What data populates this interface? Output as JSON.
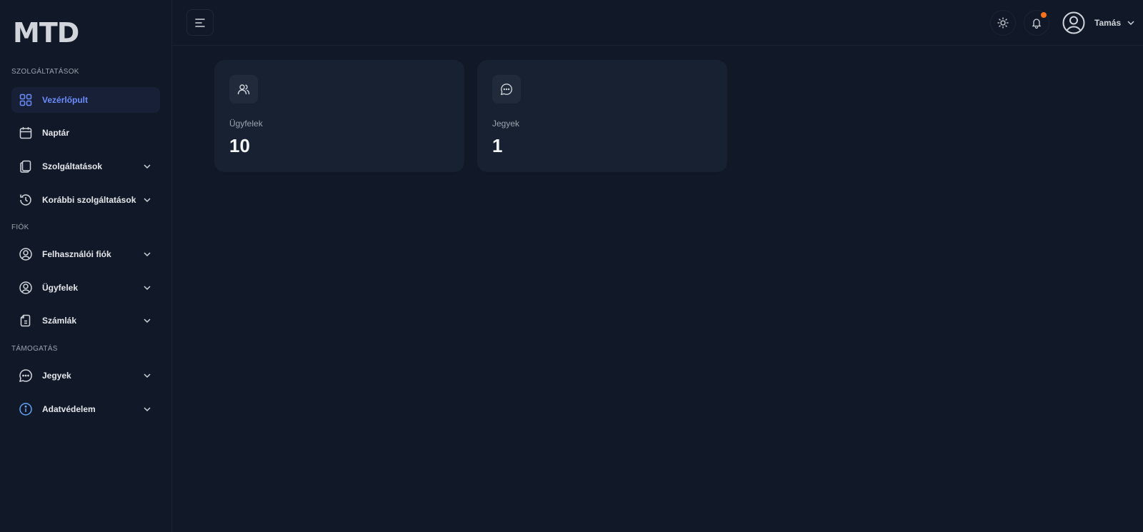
{
  "brand": {
    "logo_text": "MTD"
  },
  "sidebar": {
    "sections": [
      {
        "title": "SZOLGÁLTATÁSOK"
      },
      {
        "title": "FIÓK"
      },
      {
        "title": "TÁMOGATÁS"
      }
    ],
    "items": [
      {
        "label": "Vezérlőpult",
        "icon": "grid-icon",
        "active": true
      },
      {
        "label": "Naptár",
        "icon": "calendar-icon"
      },
      {
        "label": "Szolgáltatások",
        "icon": "copy-icon",
        "has_children": true
      },
      {
        "label": "Korábbi szolgáltatások",
        "icon": "history-icon",
        "has_children": true
      },
      {
        "label": "Felhasználói fiók",
        "icon": "user-circle-icon",
        "has_children": true
      },
      {
        "label": "Ügyfelek",
        "icon": "user-circle-icon",
        "has_children": true
      },
      {
        "label": "Számlák",
        "icon": "invoice-icon",
        "has_children": true
      },
      {
        "label": "Jegyek",
        "icon": "chat-icon",
        "has_children": true
      },
      {
        "label": "Adatvédelem",
        "icon": "info-icon",
        "has_children": true
      }
    ]
  },
  "topbar": {
    "user_name": "Tamás",
    "notification_dot_color": "#f97316"
  },
  "cards": [
    {
      "label": "Ügyfelek",
      "value": "10",
      "icon": "users-icon"
    },
    {
      "label": "Jegyek",
      "value": "1",
      "icon": "chat-icon"
    }
  ],
  "colors": {
    "background": "#111827",
    "accent": "#6d8dff",
    "card": "#182131"
  }
}
